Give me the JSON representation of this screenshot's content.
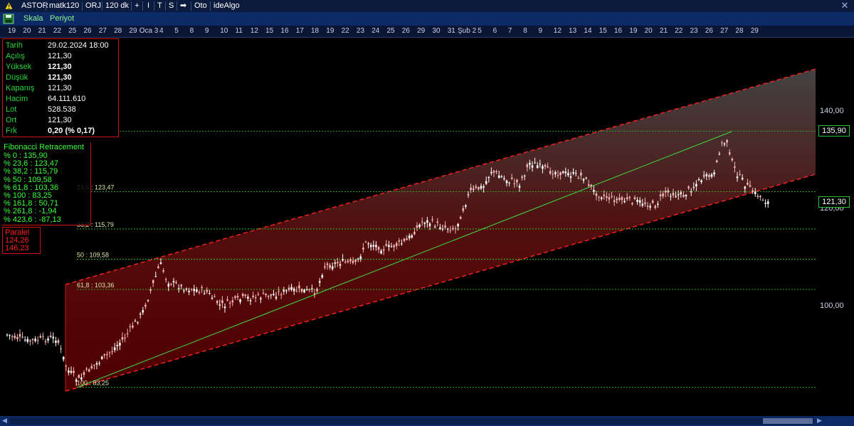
{
  "toolbar": {
    "items": [
      {
        "id": "symbol",
        "label": "ASTOR"
      },
      {
        "id": "template",
        "label": "matk120"
      },
      {
        "id": "orj",
        "label": "ORJ"
      },
      {
        "id": "period",
        "label": "120 dk"
      },
      {
        "id": "plus",
        "label": "+"
      },
      {
        "id": "cursor",
        "label": "I"
      },
      {
        "id": "text",
        "label": "T"
      },
      {
        "id": "s",
        "label": "S"
      },
      {
        "id": "arrow",
        "label": "➡"
      },
      {
        "id": "oto",
        "label": "Oto"
      },
      {
        "id": "idealgo",
        "label": "ideAlgo"
      }
    ],
    "close_icon": "close-icon"
  },
  "toolbar2": {
    "scale_label": "Skala",
    "period_label": "Periyot",
    "save_icon": "save-icon"
  },
  "dates": [
    "19",
    "20",
    "21",
    "22",
    "25",
    "26",
    "27",
    "28",
    "29",
    "Oca 3",
    "4",
    "5",
    "8",
    "9",
    "10",
    "11",
    "12",
    "15",
    "16",
    "17",
    "18",
    "19",
    "22",
    "23",
    "24",
    "25",
    "26",
    "29",
    "30",
    "31",
    "Şub 2",
    "5",
    "6",
    "7",
    "8",
    "9",
    "12",
    "13",
    "14",
    "15",
    "16",
    "19",
    "20",
    "21",
    "22",
    "23",
    "26",
    "27",
    "28",
    "29"
  ],
  "info": {
    "rows": [
      {
        "label": "Tarih",
        "value": "29.02.2024 18:00",
        "bold": false
      },
      {
        "label": "Açılış",
        "value": "121,30",
        "bold": false
      },
      {
        "label": "Yüksek",
        "value": "121,30",
        "bold": true
      },
      {
        "label": "Düşük",
        "value": "121,30",
        "bold": true
      },
      {
        "label": "Kapanış",
        "value": "121,30",
        "bold": false
      },
      {
        "label": "Hacim",
        "value": "64.111.610",
        "bold": false
      },
      {
        "label": "Lot",
        "value": "528.538",
        "bold": false
      },
      {
        "label": "Ort",
        "value": "121,30",
        "bold": false
      },
      {
        "label": "Frk",
        "value": "0,20 (% 0,17)",
        "bold": true
      }
    ]
  },
  "fib": {
    "title": "Fibonacci Retracement",
    "rows": [
      "% 0  :  135,90",
      "% 23,6  :  123,47",
      "% 38,2  :  115,79",
      "% 50  :  109,58",
      "% 61,8  :  103,36",
      "% 100  :  83,25",
      "% 161,8  :  50,71",
      "% 261,8  :  -1,94",
      "% 423,6  :  -87,13"
    ],
    "chart_labels": [
      {
        "text": "23,6 : 123,47",
        "price": 123.47
      },
      {
        "text": "38,2 : 115,79",
        "price": 115.79
      },
      {
        "text": "50 : 109,58",
        "price": 109.58
      },
      {
        "text": "61,8 : 103,36",
        "price": 103.36
      },
      {
        "text": "100 : 83,25",
        "price": 83.25
      }
    ]
  },
  "parallel": {
    "title": "Paralel",
    "v1": "124,26",
    "v2": "146,23"
  },
  "axis": {
    "ticks": [
      {
        "label": "140,00",
        "value": 140
      },
      {
        "label": "120,00",
        "value": 120
      },
      {
        "label": "100,00",
        "value": 100
      }
    ]
  },
  "price_boxes": [
    {
      "label": "135,90",
      "value": 135.9
    },
    {
      "label": "121,30",
      "value": 121.3
    }
  ],
  "colors": {
    "bg": "#000000",
    "bull": "#ffffff",
    "channel": "#ff2020",
    "fib": "#2bd82b",
    "trend": "#3fdc3f"
  }
}
